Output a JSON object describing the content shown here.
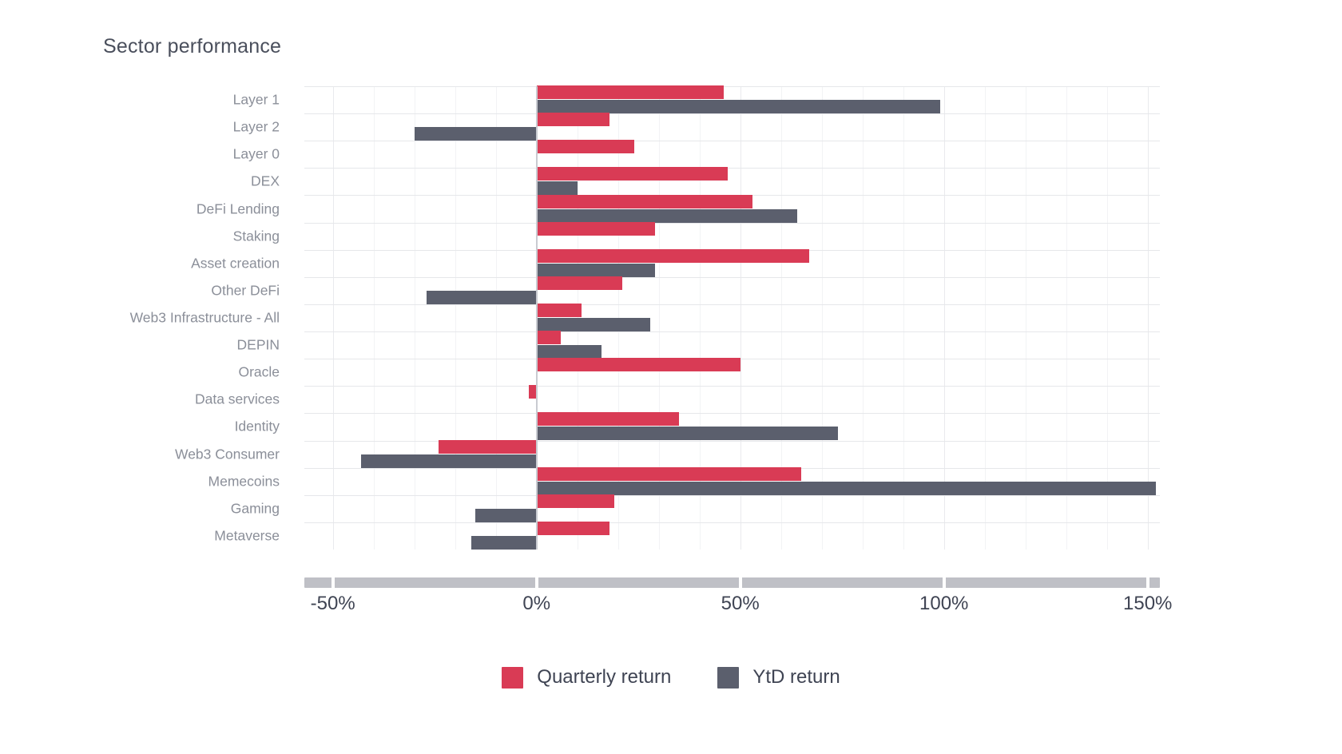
{
  "title": "Sector performance",
  "colors": {
    "quarterly": "#d93b55",
    "ytd": "#5b5f6d",
    "title_text": "#4a4f5c",
    "axis_text": "#3f4453",
    "category_text": "#8b8f99",
    "grid": "#e9eaed",
    "zero_line": "#c9cbd1",
    "axis_track": "#bfc0c6",
    "background": "#ffffff"
  },
  "legend": {
    "position": "bottom-center",
    "items": [
      {
        "label": "Quarterly return",
        "color": "#d93b55",
        "swatch": "square-swatch"
      },
      {
        "label": "YtD return",
        "color": "#5b5f6d",
        "swatch": "square-swatch"
      }
    ]
  },
  "axis": {
    "x_ticks": [
      "-50%",
      "0%",
      "50%",
      "100%",
      "150%"
    ],
    "x_tick_values": [
      -50,
      0,
      50,
      100,
      150
    ],
    "x_min": -57,
    "x_max": 153,
    "minor_gridline_step": 10
  },
  "chart_data": {
    "type": "bar",
    "orientation": "horizontal",
    "title": "Sector performance",
    "xlabel": "",
    "ylabel": "",
    "xlim": [
      -57,
      153
    ],
    "grid": true,
    "legend_position": "bottom-center",
    "value_unit": "percent",
    "categories": [
      "Layer 1",
      "Layer 2",
      "Layer 0",
      "DEX",
      "DeFi Lending",
      "Staking",
      "Asset creation",
      "Other DeFi",
      "Web3 Infrastructure - All",
      "DEPIN",
      "Oracle",
      "Data services",
      "Identity",
      "Web3 Consumer",
      "Memecoins",
      "Gaming",
      "Metaverse"
    ],
    "series": [
      {
        "name": "Quarterly return",
        "color": "#d93b55",
        "values": [
          46,
          18,
          24,
          47,
          53,
          29,
          67,
          21,
          11,
          6,
          50,
          -2,
          35,
          -24,
          65,
          19,
          18
        ]
      },
      {
        "name": "YtD return",
        "color": "#5b5f6d",
        "values": [
          99,
          -30,
          0,
          10,
          64,
          0,
          29,
          -27,
          28,
          16,
          0,
          0,
          74,
          -43,
          152,
          -15,
          -16
        ]
      }
    ]
  }
}
